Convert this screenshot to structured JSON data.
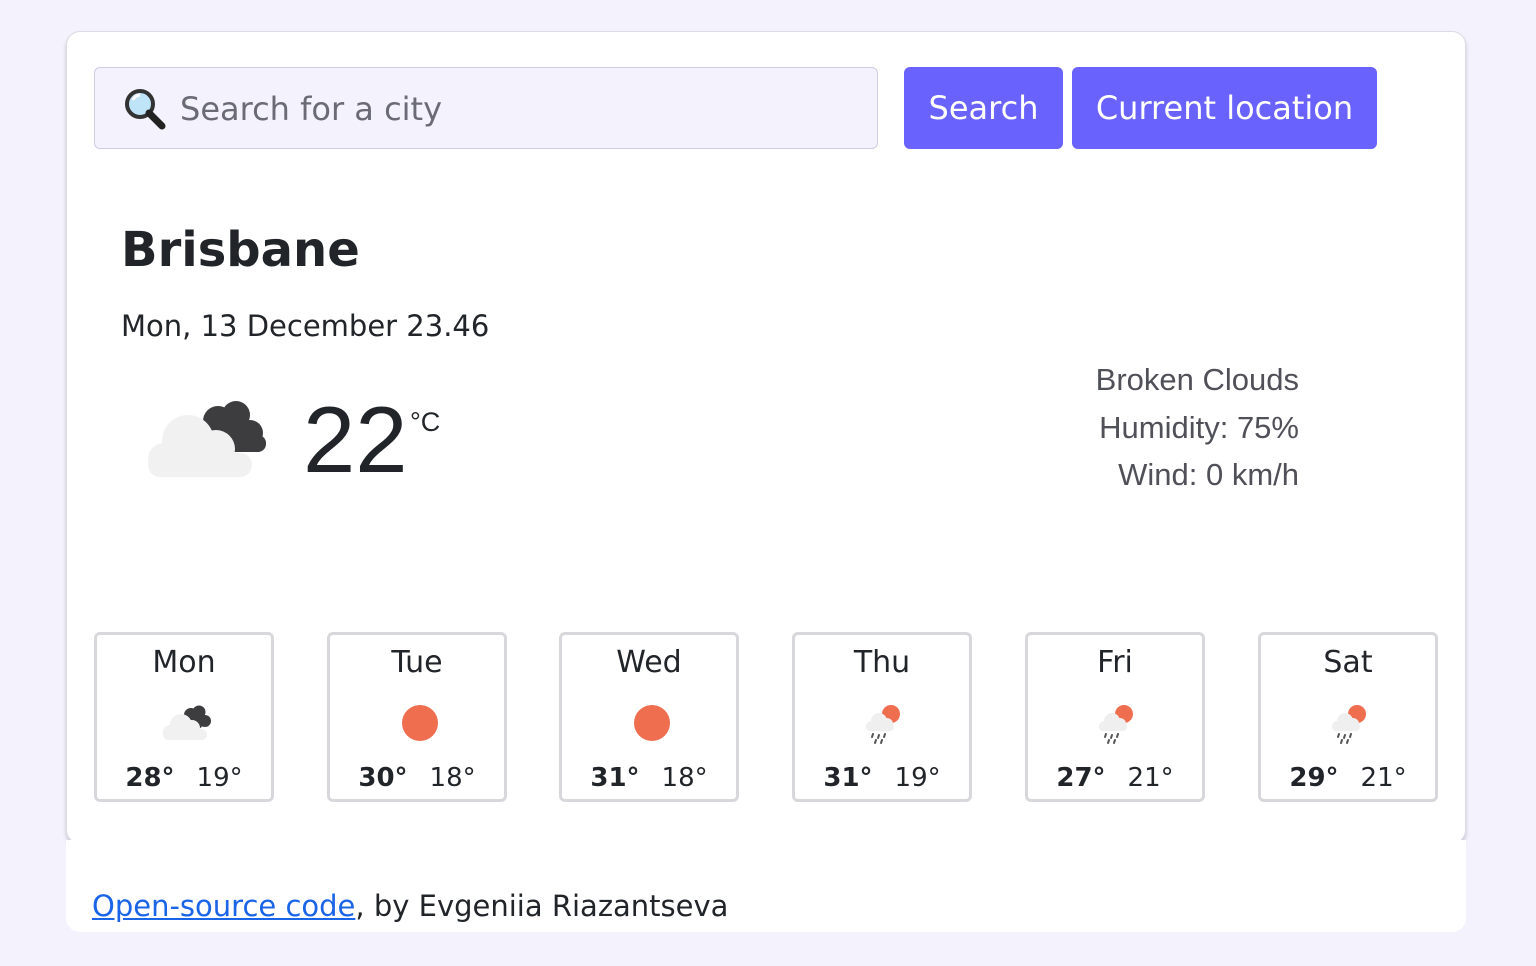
{
  "search": {
    "placeholder": "Search for a city",
    "icon": "magnifier-icon",
    "button_label": "Search",
    "location_label": "Current location"
  },
  "current": {
    "city": "Brisbane",
    "datetime": "Mon, 13 December 23.46",
    "icon": "broken-clouds-icon",
    "temperature": "22",
    "unit": "°C",
    "description": "Broken Clouds",
    "humidity": "Humidity: 75%",
    "wind": "Wind: 0 km/h"
  },
  "forecast": [
    {
      "day": "Mon",
      "icon": "broken-clouds-icon",
      "max": "28°",
      "min": "19°"
    },
    {
      "day": "Tue",
      "icon": "sun-icon",
      "max": "30°",
      "min": "18°"
    },
    {
      "day": "Wed",
      "icon": "sun-icon",
      "max": "31°",
      "min": "18°"
    },
    {
      "day": "Thu",
      "icon": "sun-rain-icon",
      "max": "31°",
      "min": "19°"
    },
    {
      "day": "Fri",
      "icon": "sun-rain-icon",
      "max": "27°",
      "min": "21°"
    },
    {
      "day": "Sat",
      "icon": "sun-rain-icon",
      "max": "29°",
      "min": "21°"
    }
  ],
  "footer": {
    "link_text": "Open-source code",
    "author_text": ", by Evgeniia Riazantseva"
  },
  "colors": {
    "accent": "#6962fd",
    "background": "#f4f2fd",
    "sun": "#ee6e4f",
    "link": "#1a64e8"
  }
}
